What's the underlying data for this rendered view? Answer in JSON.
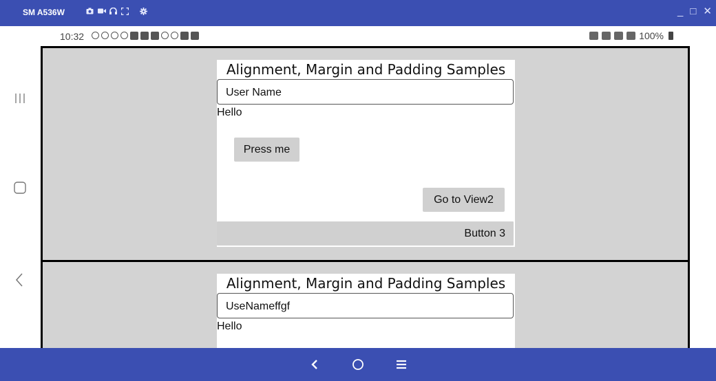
{
  "titlebar": {
    "device_name": "SM A536W",
    "icons": [
      "camera-icon",
      "video-icon",
      "headphones-icon",
      "fullscreen-icon",
      "gear-icon"
    ],
    "controls": {
      "minimize": "_",
      "restore": "□",
      "close": "✕"
    }
  },
  "statusbar": {
    "time": "10:32",
    "battery": "100%",
    "notification_icons": [
      "minus-circle-icon",
      "sync-icon",
      "messenger-icon",
      "messenger-icon",
      "app-icon",
      "app-icon",
      "mail-icon",
      "chrome-icon",
      "chrome-icon",
      "wrench-icon",
      "app-icon"
    ],
    "right_icons": [
      "bed-icon",
      "alarm-icon",
      "wifi-icon",
      "signal-icon",
      "battery-icon"
    ]
  },
  "app_top": {
    "title": "Alignment, Margin and Padding Samples",
    "input_value": "User Name",
    "hello": "Hello",
    "press_button": "Press me",
    "view2_button": "Go to View2",
    "button3": "Button 3"
  },
  "app_bottom": {
    "title": "Alignment, Margin and Padding Samples",
    "input_value": "UseNameffgf",
    "hello": "Hello"
  },
  "colors": {
    "chrome_blue": "#3b4fb2",
    "page_gray": "#d3d3d3",
    "button_gray": "#d0d0d0"
  }
}
